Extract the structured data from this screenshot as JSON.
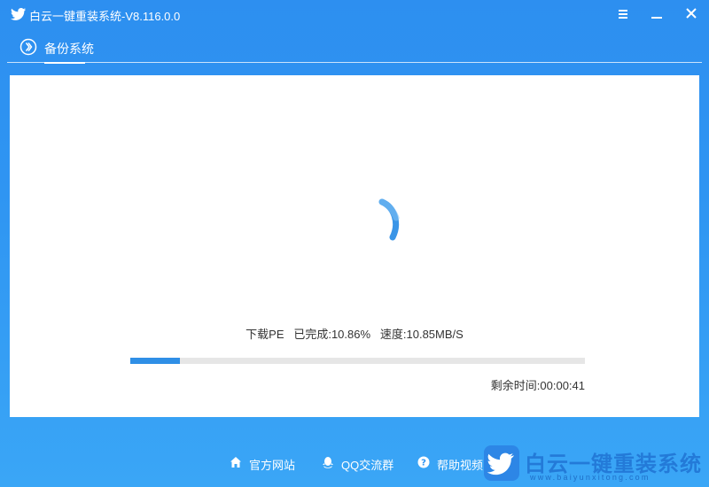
{
  "window": {
    "title": "白云一键重装系统-V8.116.0.0",
    "controls": [
      "menu-icon",
      "minimize-icon",
      "close-icon"
    ]
  },
  "tabs": [
    {
      "label": "备份系统",
      "icon": "chevron-right-circle-icon",
      "active": true
    }
  ],
  "download": {
    "item": "下载PE",
    "completed": "已完成:10.86%",
    "speed": "速度:10.85MB/S",
    "remaining": "剩余时间:00:00:41",
    "progress_percent": 10.86
  },
  "footer": {
    "links": [
      {
        "label": "官方网站",
        "icon": "home-icon"
      },
      {
        "label": "QQ交流群",
        "icon": "qq-icon"
      },
      {
        "label": "帮助视频",
        "icon": "help-icon"
      }
    ]
  },
  "watermark": {
    "title": "白云一键重装系统",
    "url": "www.baiyunxitong.com"
  },
  "colors": {
    "background": "#2f95f2",
    "accent": "#2f8fe6",
    "panel": "#ffffff"
  }
}
